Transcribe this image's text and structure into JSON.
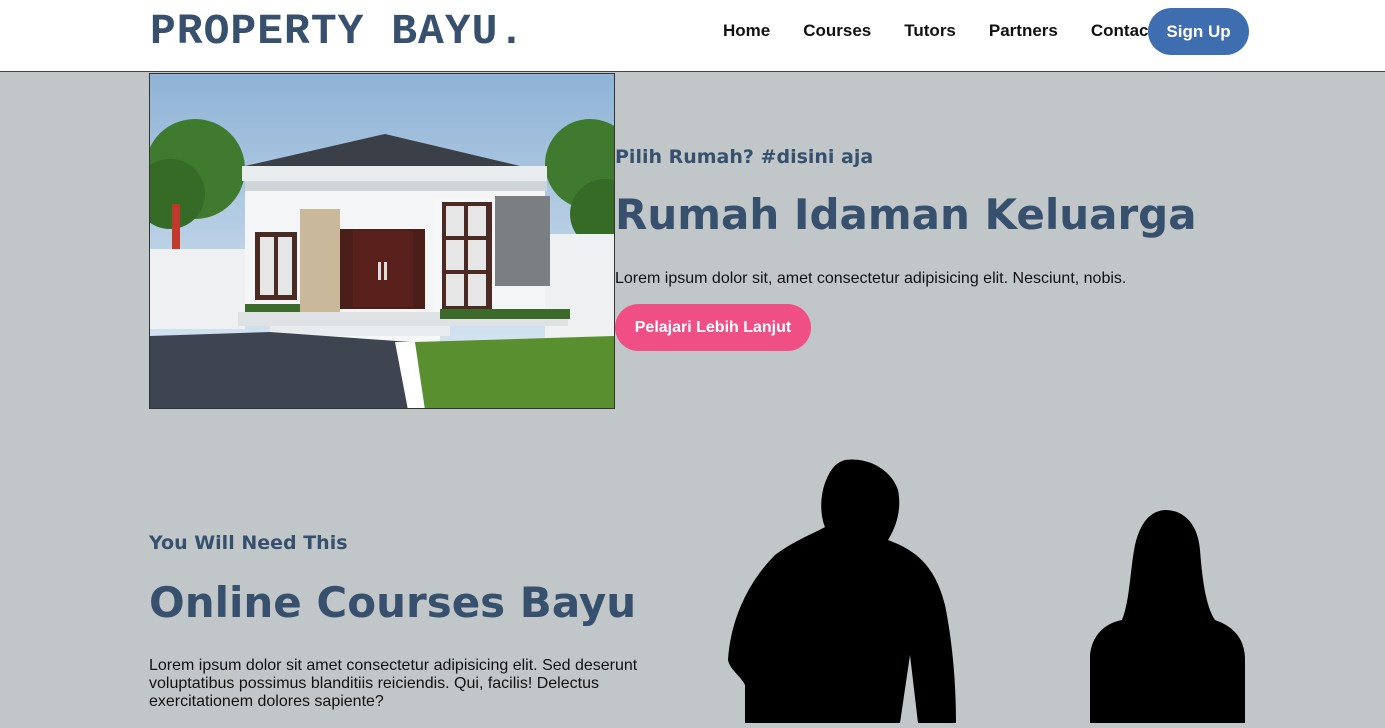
{
  "navbar": {
    "brand": "PROPERTY BAYU.",
    "links": [
      "Home",
      "Courses",
      "Tutors",
      "Partners",
      "Contact"
    ],
    "signup_label": "Sign Up"
  },
  "hero": {
    "subtitle": "Pilih Rumah? #disini aja",
    "title": "Rumah Idaman Keluarga",
    "text": "Lorem ipsum dolor sit, amet consectetur adipisicing elit. Nesciunt, nobis.",
    "button_label": "Pelajari Lebih Lanjut"
  },
  "courses": {
    "subtitle": "You Will Need This",
    "title": "Online Courses Bayu",
    "text": "Lorem ipsum dolor sit amet consectetur adipisicing elit. Sed deserunt voluptatibus possimus blanditiis reiciendis. Qui, facilis! Delectus exercitationem dolores sapiente?"
  },
  "colors": {
    "background": "#c1c7c8",
    "brand": "#36506e",
    "signup": "#3e6eaf",
    "cta": "#ef4f85"
  }
}
